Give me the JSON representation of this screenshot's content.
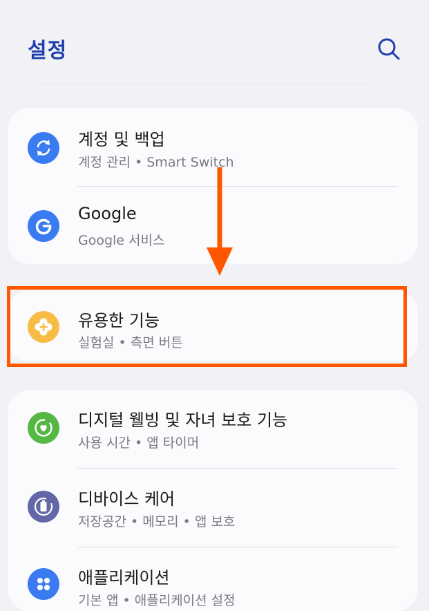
{
  "header": {
    "title": "설정",
    "search_icon": "search-icon"
  },
  "groups": [
    {
      "items": [
        {
          "title": "계정 및 백업",
          "subtitle": "계정 관리  •  Smart Switch",
          "icon": "sync-icon",
          "color": "#3a7bf2"
        },
        {
          "title": "Google",
          "subtitle": "Google 서비스",
          "icon": "google-icon",
          "color": "#3a7bf2"
        }
      ]
    },
    {
      "items": [
        {
          "title": "유용한 기능",
          "subtitle": "실험실  •  측면 버튼",
          "icon": "puzzle-plus-icon",
          "color": "#f7bc46"
        }
      ]
    },
    {
      "items": [
        {
          "title": "디지털 웰빙 및 자녀 보호 기능",
          "subtitle": "사용 시간  •  앱 타이머",
          "icon": "heart-circle-icon",
          "color": "#55b845"
        },
        {
          "title": "디바이스 케어",
          "subtitle": "저장공간  •  메모리  •  앱 보호",
          "icon": "battery-care-icon",
          "color": "#6367a8"
        },
        {
          "title": "애플리케이션",
          "subtitle": "기본 앱  •  애플리케이션 설정",
          "icon": "apps-grid-icon",
          "color": "#3a7bf2"
        }
      ]
    }
  ],
  "annotation": {
    "highlight_color": "#ff5700"
  }
}
